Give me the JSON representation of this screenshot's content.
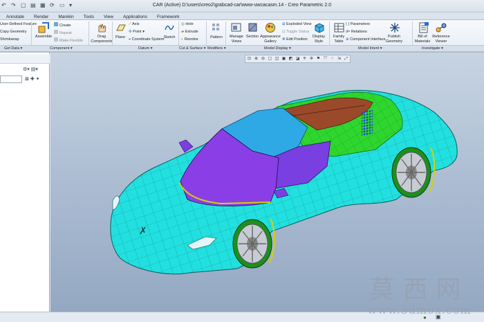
{
  "titlebar": {
    "title": "CAR (Active) D:\\users\\creo2\\grabcad-car\\www-uwcacasm.14 - Creo Parametric 2.0"
  },
  "tabs": [
    "Annotate",
    "Render",
    "Manikin",
    "Tools",
    "View",
    "Applications",
    "Framework"
  ],
  "ribbon": {
    "user_defined_feature": "User-Defined Feature",
    "copy_geometry": "Copy Geometry",
    "shrinkwrap": "Shrinkwrap",
    "assemble": "Assemble",
    "create": "Create",
    "repeat": "Repeat",
    "mate_flexible": "Make Flexible",
    "drag_components": "Drag Components",
    "plane": "Plane",
    "axis": "Axis",
    "point": "Point",
    "coordinate_system": "Coordinate System",
    "sketch": "Sketch",
    "hole": "Hole",
    "extrude": "Extrude",
    "revolve": "Revolve",
    "pattern": "Pattern",
    "manage_views": "Manage Views",
    "section": "Section",
    "appearance_gallery": "Appearance Gallery",
    "exploded_view": "Exploded View",
    "toggle_status": "Toggle Status",
    "edit_position": "Edit Position",
    "display_style": "Display Style",
    "family_table": "Family Table",
    "parameters": "Parameters",
    "relations": "Relations",
    "component_interface": "Component Interface",
    "publish_geometry": "Publish Geometry",
    "bill_of_materials": "Bill of Materials",
    "reference_viewer": "Reference Viewer"
  },
  "groups": {
    "get_data": "Get Data",
    "component": "Component",
    "datum": "Datum",
    "cut_surface": "Cut & Surface",
    "modifiers": "Modifiers",
    "model_display": "Model Display",
    "model_intent": "Model Intent",
    "investigate": "Investigate"
  },
  "watermark": {
    "chinese": "莫西网",
    "url": "www.3dmox.com"
  },
  "colors": {
    "car_body": "#22e0df",
    "windshield": "#8a3fe6",
    "roof": "#2fa9e6",
    "green_panel": "#2ed62e",
    "brown_panel": "#9a4a2a",
    "viewport_top": "#c8d4e2",
    "viewport_bottom": "#94a8c2"
  }
}
